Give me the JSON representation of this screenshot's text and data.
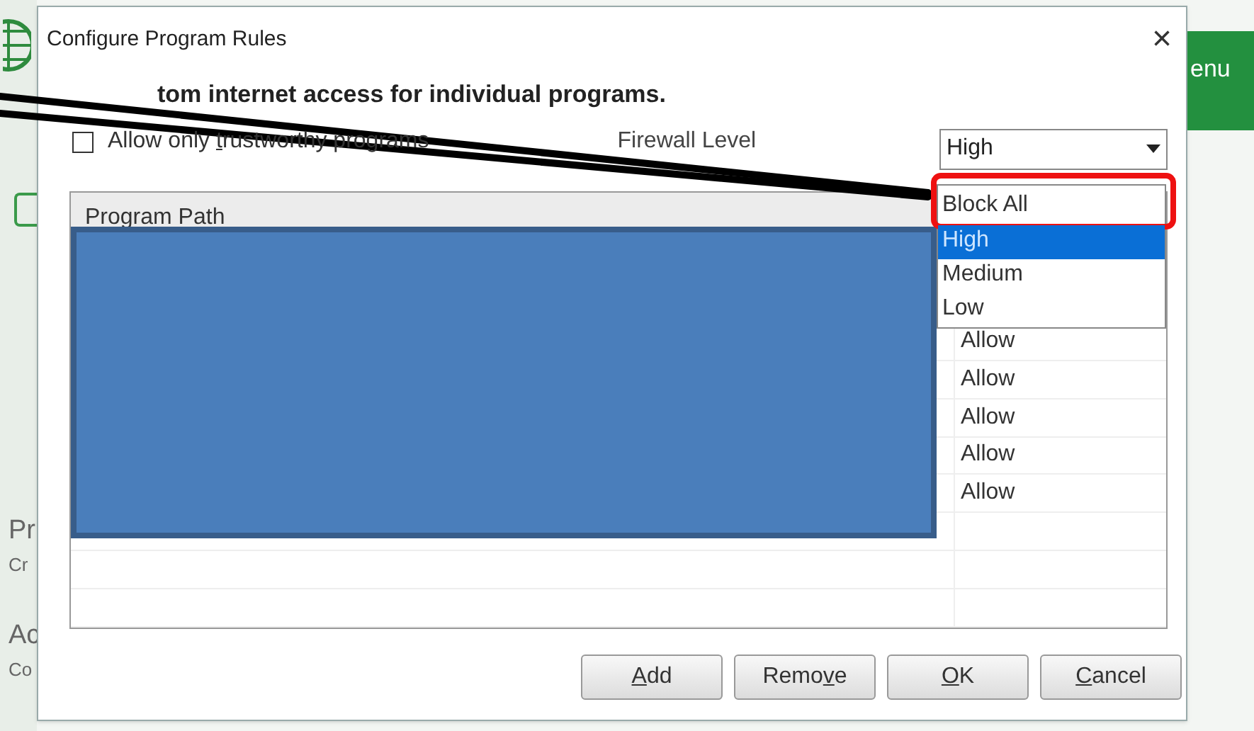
{
  "background_app": {
    "left_texts": [
      "Pr",
      "Cr",
      "Ac",
      "Co"
    ],
    "menu_text": "enu"
  },
  "dialog": {
    "title": "Configure Program Rules",
    "close": "×",
    "heading": "tom internet access for individual programs.",
    "trustworthy_only": {
      "label": {
        "before": "Allow only ",
        "key": "t",
        "after": "rustworthy programs"
      },
      "checked": false
    },
    "firewall_level": {
      "label": "Firewall Level",
      "value": "High",
      "options": [
        {
          "label": "Block All",
          "selected": false,
          "annotated": true
        },
        {
          "label": "High",
          "selected": true,
          "annotated": false
        },
        {
          "label": "Medium",
          "selected": false,
          "annotated": false
        },
        {
          "label": "Low",
          "selected": false,
          "annotated": false
        }
      ]
    },
    "table": {
      "columns": [
        "Program Path"
      ],
      "rows": [
        {
          "column_2": "Allow"
        },
        {
          "column_2": "Allow"
        },
        {
          "column_2": "Allow"
        },
        {
          "column_2": "Allow"
        },
        {
          "column_2": "Allow"
        }
      ]
    },
    "buttons": [
      {
        "label": {
          "key": "A",
          "after": "dd"
        }
      },
      {
        "label": {
          "before": "Remo",
          "key": "v",
          "after": "e"
        }
      },
      {
        "label": {
          "key": "O",
          "after": "K"
        }
      },
      {
        "label": {
          "key": "C",
          "after": "ancel"
        }
      }
    ]
  }
}
